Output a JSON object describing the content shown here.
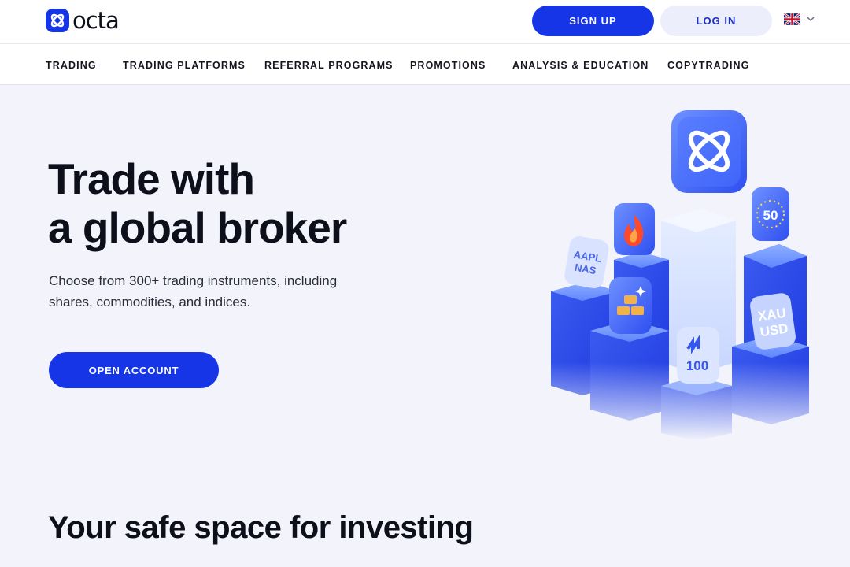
{
  "header": {
    "logo_text": "octa",
    "signup_label": "SIGN UP",
    "login_label": "LOG IN",
    "language": "English (UK)"
  },
  "nav": {
    "items": [
      {
        "label": "TRADING"
      },
      {
        "label": "TRADING PLATFORMS"
      },
      {
        "label": "REFERRAL PROGRAMS"
      },
      {
        "label": "PROMOTIONS"
      },
      {
        "label": "ANALYSIS & EDUCATION"
      },
      {
        "label": "COPYTRADING"
      }
    ]
  },
  "hero": {
    "title_line1": "Trade with",
    "title_line2": "a global broker",
    "subtitle": "Choose from 300+ trading instruments, including shares, commodities, and indices.",
    "cta_label": "OPEN ACCOUNT",
    "illustration_badges": [
      {
        "line1": "AAPL",
        "line2": "NAS"
      },
      {
        "line1": "50",
        "line2": ""
      },
      {
        "line1": "XAU",
        "line2": "USD"
      },
      {
        "line1": "100",
        "line2": ""
      }
    ]
  },
  "sections": {
    "safe_space_title": "Your safe space for investing"
  },
  "colors": {
    "brand_blue": "#1535e6",
    "page_bg": "#f3f4fb",
    "login_bg": "#eceefb"
  },
  "icons": [
    "octa-logo-icon",
    "uk-flag-icon",
    "chevron-down-icon",
    "flame-icon",
    "gold-bars-icon",
    "sparkle-icon"
  ]
}
